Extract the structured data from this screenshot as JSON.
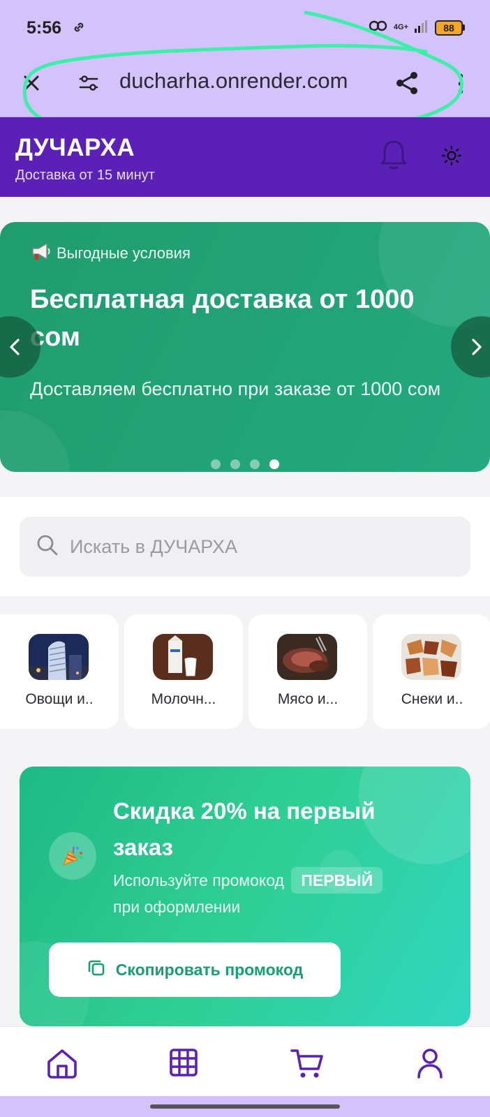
{
  "status_bar": {
    "time": "5:56",
    "network": "4G+",
    "battery": "88"
  },
  "browser": {
    "url": "ducharha.onrender.com"
  },
  "header": {
    "title": "ДУЧАРХА",
    "subtitle": "Доставка от 15 минут"
  },
  "hero": {
    "tag": "Выгодные условия",
    "title": "Бесплатная доставка от 1000 сом",
    "description": "Доставляем бесплатно при заказе от 1000 сом",
    "slide_count": 4,
    "active_slide": 4
  },
  "search": {
    "placeholder": "Искать в ДУЧАРХА"
  },
  "categories": [
    {
      "label": "Овощи и.."
    },
    {
      "label": "Молочн..."
    },
    {
      "label": "Мясо и..."
    },
    {
      "label": "Снеки и.."
    }
  ],
  "promo": {
    "title": "Скидка 20% на первый заказ",
    "text_before": "Используйте промокод",
    "code": "ПЕРВЫЙ",
    "text_after": "при оформлении",
    "button": "Скопировать промокод"
  },
  "colors": {
    "browser_bg": "#d3c2fb",
    "header_bg": "#5b21b6",
    "hero_green": "#1f9d6e",
    "promo_green": "#2fcf94",
    "nav_icon": "#5b21b6",
    "annotation": "#3df0a8"
  },
  "icons": {
    "hero_tag": "megaphone-icon",
    "promo": "party-popper-icon"
  }
}
